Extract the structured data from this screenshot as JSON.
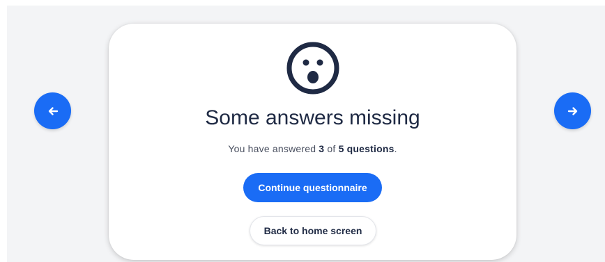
{
  "navigation": {
    "prev_icon": "arrow-left-icon",
    "next_icon": "arrow-right-icon"
  },
  "dialog": {
    "icon": "surprised-face-icon",
    "title": "Some answers missing",
    "status": {
      "prefix": "You have answered",
      "answered": "3",
      "separator": "of",
      "total": "5 questions",
      "suffix": "."
    },
    "continue_label": "Continue questionnaire",
    "home_label": "Back to home screen"
  },
  "colors": {
    "accent": "#1a6cf5",
    "text_dark": "#1f2a44",
    "icon": "#1f2a44",
    "background": "#f3f4f6"
  }
}
